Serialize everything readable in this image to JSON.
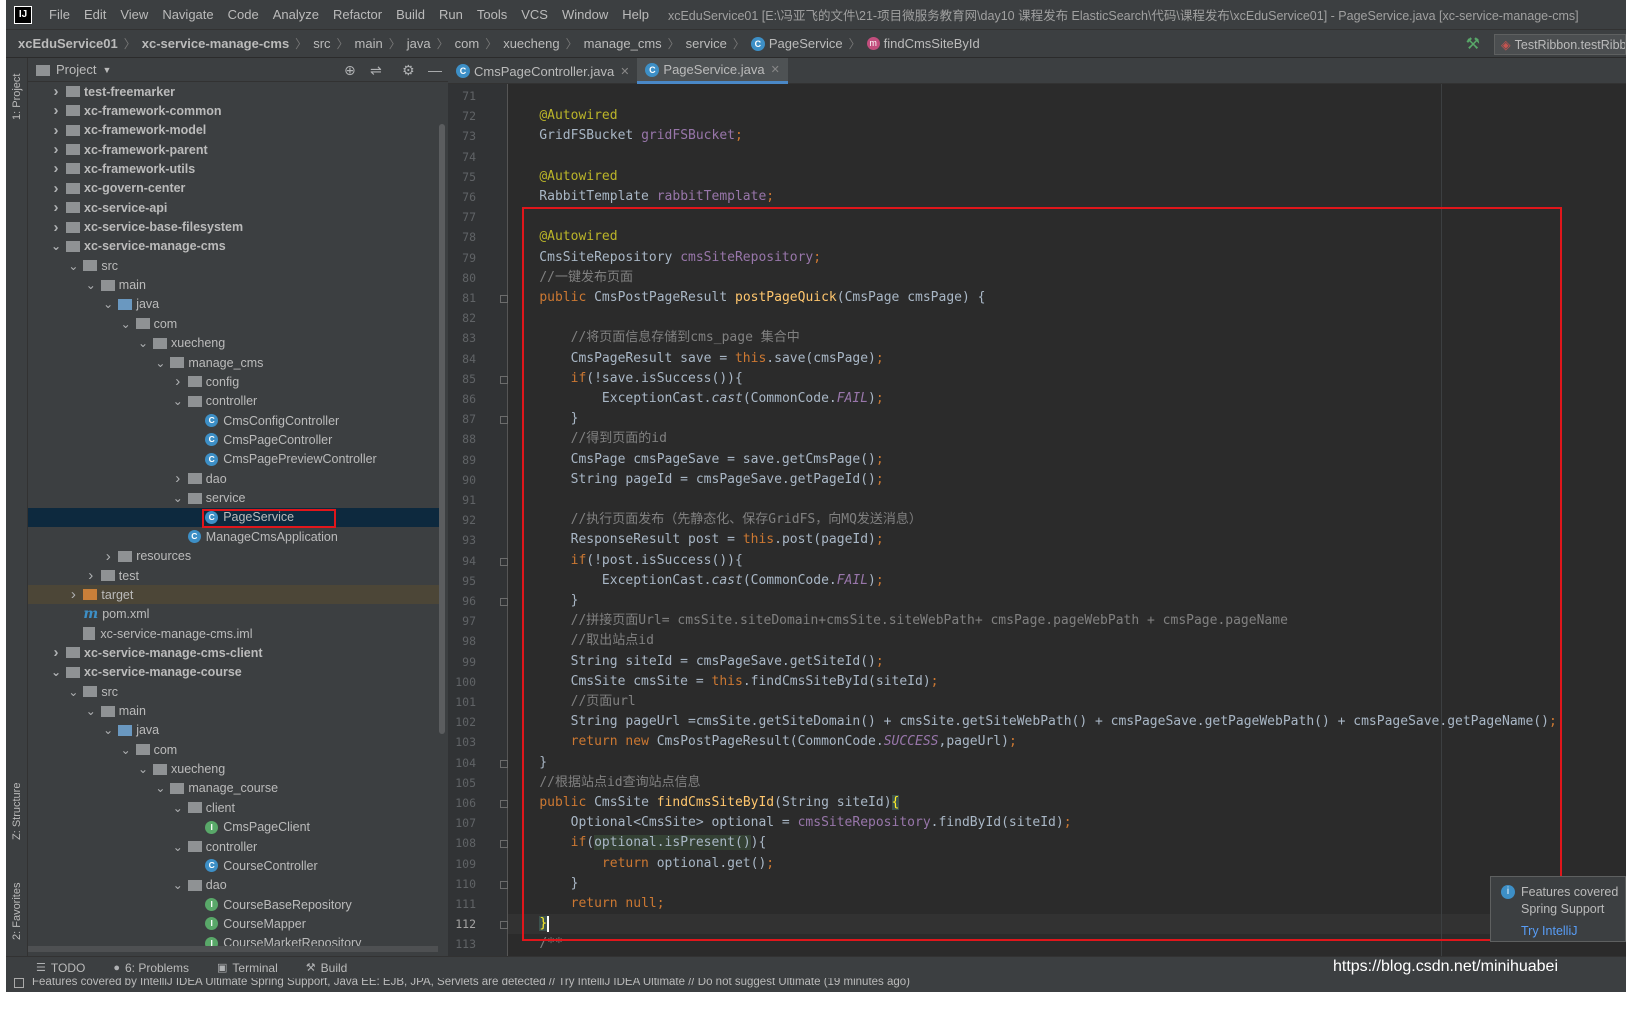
{
  "window": {
    "menu": [
      "File",
      "Edit",
      "View",
      "Navigate",
      "Code",
      "Analyze",
      "Refactor",
      "Build",
      "Run",
      "Tools",
      "VCS",
      "Window",
      "Help"
    ],
    "title": "xcEduService01 [E:\\冯亚飞的文件\\21-项目微服务教育网\\day10 课程发布 ElasticSearch\\代码\\课程发布\\xcEduService01] - PageService.java [xc-service-manage-cms]"
  },
  "breadcrumb": {
    "items": [
      "xcEduService01",
      "xc-service-manage-cms",
      "src",
      "main",
      "java",
      "com",
      "xuecheng",
      "manage_cms",
      "service",
      "PageService",
      "findCmsSiteById"
    ],
    "run_config": "TestRibbon.testRibbon"
  },
  "side_tabs": {
    "project": "1: Project",
    "structure": "Z: Structure",
    "favorites": "2: Favorites"
  },
  "project_panel": {
    "title": "Project",
    "tree": [
      {
        "label": "test-freemarker",
        "depth": 0,
        "arrow": "right",
        "icon": "module-folder",
        "bold": true
      },
      {
        "label": "xc-framework-common",
        "depth": 0,
        "arrow": "right",
        "icon": "module-folder",
        "bold": true
      },
      {
        "label": "xc-framework-model",
        "depth": 0,
        "arrow": "right",
        "icon": "module-folder",
        "bold": true
      },
      {
        "label": "xc-framework-parent",
        "depth": 0,
        "arrow": "right",
        "icon": "module-folder",
        "bold": true
      },
      {
        "label": "xc-framework-utils",
        "depth": 0,
        "arrow": "right",
        "icon": "module-folder",
        "bold": true
      },
      {
        "label": "xc-govern-center",
        "depth": 0,
        "arrow": "right",
        "icon": "module-folder",
        "bold": true
      },
      {
        "label": "xc-service-api",
        "depth": 0,
        "arrow": "right",
        "icon": "module-folder",
        "bold": true
      },
      {
        "label": "xc-service-base-filesystem",
        "depth": 0,
        "arrow": "right",
        "icon": "module-folder",
        "bold": true
      },
      {
        "label": "xc-service-manage-cms",
        "depth": 0,
        "arrow": "down",
        "icon": "module-folder",
        "bold": true
      },
      {
        "label": "src",
        "depth": 1,
        "arrow": "down",
        "icon": "folder"
      },
      {
        "label": "main",
        "depth": 2,
        "arrow": "down",
        "icon": "folder"
      },
      {
        "label": "java",
        "depth": 3,
        "arrow": "down",
        "icon": "folder-blue"
      },
      {
        "label": "com",
        "depth": 4,
        "arrow": "down",
        "icon": "package"
      },
      {
        "label": "xuecheng",
        "depth": 5,
        "arrow": "down",
        "icon": "package"
      },
      {
        "label": "manage_cms",
        "depth": 6,
        "arrow": "down",
        "icon": "package"
      },
      {
        "label": "config",
        "depth": 7,
        "arrow": "right",
        "icon": "package"
      },
      {
        "label": "controller",
        "depth": 7,
        "arrow": "down",
        "icon": "package"
      },
      {
        "label": "CmsConfigController",
        "depth": 8,
        "arrow": "",
        "icon": "class"
      },
      {
        "label": "CmsPageController",
        "depth": 8,
        "arrow": "",
        "icon": "class"
      },
      {
        "label": "CmsPagePreviewController",
        "depth": 8,
        "arrow": "",
        "icon": "class"
      },
      {
        "label": "dao",
        "depth": 7,
        "arrow": "right",
        "icon": "package"
      },
      {
        "label": "service",
        "depth": 7,
        "arrow": "down",
        "icon": "package"
      },
      {
        "label": "PageService",
        "depth": 8,
        "arrow": "",
        "icon": "class",
        "selected": true
      },
      {
        "label": "ManageCmsApplication",
        "depth": 7,
        "arrow": "",
        "icon": "class"
      },
      {
        "label": "resources",
        "depth": 3,
        "arrow": "right",
        "icon": "folder"
      },
      {
        "label": "test",
        "depth": 2,
        "arrow": "right",
        "icon": "folder"
      },
      {
        "label": "target",
        "depth": 1,
        "arrow": "right",
        "icon": "folder-orange",
        "highlight": true
      },
      {
        "label": "pom.xml",
        "depth": 1,
        "arrow": "",
        "icon": "maven"
      },
      {
        "label": "xc-service-manage-cms.iml",
        "depth": 1,
        "arrow": "",
        "icon": "file"
      },
      {
        "label": "xc-service-manage-cms-client",
        "depth": 0,
        "arrow": "right",
        "icon": "module-folder",
        "bold": true
      },
      {
        "label": "xc-service-manage-course",
        "depth": 0,
        "arrow": "down",
        "icon": "module-folder",
        "bold": true
      },
      {
        "label": "src",
        "depth": 1,
        "arrow": "down",
        "icon": "folder"
      },
      {
        "label": "main",
        "depth": 2,
        "arrow": "down",
        "icon": "folder"
      },
      {
        "label": "java",
        "depth": 3,
        "arrow": "down",
        "icon": "folder-blue"
      },
      {
        "label": "com",
        "depth": 4,
        "arrow": "down",
        "icon": "package"
      },
      {
        "label": "xuecheng",
        "depth": 5,
        "arrow": "down",
        "icon": "package"
      },
      {
        "label": "manage_course",
        "depth": 6,
        "arrow": "down",
        "icon": "package"
      },
      {
        "label": "client",
        "depth": 7,
        "arrow": "down",
        "icon": "package"
      },
      {
        "label": "CmsPageClient",
        "depth": 8,
        "arrow": "",
        "icon": "interface"
      },
      {
        "label": "controller",
        "depth": 7,
        "arrow": "down",
        "icon": "package"
      },
      {
        "label": "CourseController",
        "depth": 8,
        "arrow": "",
        "icon": "class"
      },
      {
        "label": "dao",
        "depth": 7,
        "arrow": "down",
        "icon": "package"
      },
      {
        "label": "CourseBaseRepository",
        "depth": 8,
        "arrow": "",
        "icon": "interface"
      },
      {
        "label": "CourseMapper",
        "depth": 8,
        "arrow": "",
        "icon": "interface"
      },
      {
        "label": "CourseMarketRepository",
        "depth": 8,
        "arrow": "",
        "icon": "interface"
      }
    ]
  },
  "editor": {
    "tabs": [
      {
        "label": "CmsPageController.java",
        "active": false
      },
      {
        "label": "PageService.java",
        "active": true
      }
    ],
    "current_line": 112,
    "lines": [
      {
        "n": 71,
        "t": []
      },
      {
        "n": 72,
        "t": [
          [
            "    ",
            ""
          ],
          [
            "@Autowired",
            "ann"
          ]
        ]
      },
      {
        "n": 73,
        "t": [
          [
            "    GridFSBucket ",
            ""
          ],
          [
            "gridFSBucket",
            "fld"
          ],
          [
            ";",
            "kw"
          ]
        ]
      },
      {
        "n": 74,
        "t": []
      },
      {
        "n": 75,
        "t": [
          [
            "    ",
            ""
          ],
          [
            "@Autowired",
            "ann"
          ]
        ]
      },
      {
        "n": 76,
        "t": [
          [
            "    RabbitTemplate ",
            ""
          ],
          [
            "rabbitTemplate",
            "fld"
          ],
          [
            ";",
            "kw"
          ]
        ]
      },
      {
        "n": 77,
        "t": []
      },
      {
        "n": 78,
        "t": [
          [
            "    ",
            ""
          ],
          [
            "@Autowired",
            "ann"
          ]
        ]
      },
      {
        "n": 79,
        "t": [
          [
            "    CmsSiteRepository ",
            ""
          ],
          [
            "cmsSiteRepository",
            "fld"
          ],
          [
            ";",
            "kw"
          ]
        ]
      },
      {
        "n": 80,
        "t": [
          [
            "    ",
            ""
          ],
          [
            "//一键发布页面",
            "cm"
          ]
        ]
      },
      {
        "n": 81,
        "t": [
          [
            "    ",
            ""
          ],
          [
            "public ",
            "kw"
          ],
          [
            "CmsPostPageResult ",
            ""
          ],
          [
            "postPageQuick",
            "fn"
          ],
          [
            "(CmsPage cmsPage) {",
            ""
          ]
        ]
      },
      {
        "n": 82,
        "t": []
      },
      {
        "n": 83,
        "t": [
          [
            "        ",
            ""
          ],
          [
            "//将页面信息存储到cms_page 集合中",
            "cm"
          ]
        ]
      },
      {
        "n": 84,
        "t": [
          [
            "        CmsPageResult save = ",
            ""
          ],
          [
            "this",
            "kw"
          ],
          [
            ".save(cmsPage)",
            ""
          ],
          [
            ";",
            "kw"
          ]
        ]
      },
      {
        "n": 85,
        "t": [
          [
            "        ",
            ""
          ],
          [
            "if",
            "kw"
          ],
          [
            "(!save.isSuccess()){",
            ""
          ]
        ]
      },
      {
        "n": 86,
        "t": [
          [
            "            ExceptionCast.",
            ""
          ],
          [
            "cast",
            "it"
          ],
          [
            "(CommonCode.",
            ""
          ],
          [
            "FAIL",
            "fld it"
          ],
          [
            ")",
            ""
          ],
          [
            ";",
            "kw"
          ]
        ]
      },
      {
        "n": 87,
        "t": [
          [
            "        }",
            ""
          ]
        ]
      },
      {
        "n": 88,
        "t": [
          [
            "        ",
            ""
          ],
          [
            "//得到页面的id",
            "cm"
          ]
        ]
      },
      {
        "n": 89,
        "t": [
          [
            "        CmsPage cmsPageSave = save.getCmsPage()",
            ""
          ],
          [
            ";",
            "kw"
          ]
        ]
      },
      {
        "n": 90,
        "t": [
          [
            "        String pageId = cmsPageSave.getPageId()",
            ""
          ],
          [
            ";",
            "kw"
          ]
        ]
      },
      {
        "n": 91,
        "t": []
      },
      {
        "n": 92,
        "t": [
          [
            "        ",
            ""
          ],
          [
            "//执行页面发布（先静态化、保存GridFS，向MQ发送消息）",
            "cm"
          ]
        ]
      },
      {
        "n": 93,
        "t": [
          [
            "        ResponseResult post = ",
            ""
          ],
          [
            "this",
            "kw"
          ],
          [
            ".post(pageId)",
            ""
          ],
          [
            ";",
            "kw"
          ]
        ]
      },
      {
        "n": 94,
        "t": [
          [
            "        ",
            ""
          ],
          [
            "if",
            "kw"
          ],
          [
            "(!post.isSuccess()){",
            ""
          ]
        ]
      },
      {
        "n": 95,
        "t": [
          [
            "            ExceptionCast.",
            ""
          ],
          [
            "cast",
            "it"
          ],
          [
            "(CommonCode.",
            ""
          ],
          [
            "FAIL",
            "fld it"
          ],
          [
            ")",
            ""
          ],
          [
            ";",
            "kw"
          ]
        ]
      },
      {
        "n": 96,
        "t": [
          [
            "        }",
            ""
          ]
        ]
      },
      {
        "n": 97,
        "t": [
          [
            "        ",
            ""
          ],
          [
            "//拼接页面Url= cmsSite.siteDomain+cmsSite.siteWebPath+ cmsPage.pageWebPath + cmsPage.pageName",
            "cm"
          ]
        ]
      },
      {
        "n": 98,
        "t": [
          [
            "        ",
            ""
          ],
          [
            "//取出站点id",
            "cm"
          ]
        ]
      },
      {
        "n": 99,
        "t": [
          [
            "        String siteId = cmsPageSave.getSiteId()",
            ""
          ],
          [
            ";",
            "kw"
          ]
        ]
      },
      {
        "n": 100,
        "t": [
          [
            "        CmsSite cmsSite = ",
            ""
          ],
          [
            "this",
            "kw"
          ],
          [
            ".findCmsSiteById(siteId)",
            ""
          ],
          [
            ";",
            "kw"
          ]
        ]
      },
      {
        "n": 101,
        "t": [
          [
            "        ",
            ""
          ],
          [
            "//页面url",
            "cm"
          ]
        ]
      },
      {
        "n": 102,
        "t": [
          [
            "        String pageUrl =cmsSite.getSiteDomain() + cmsSite.getSiteWebPath() + cmsPageSave.getPageWebPath() + cmsPageSave.getPageName()",
            ""
          ],
          [
            ";",
            "kw"
          ]
        ]
      },
      {
        "n": 103,
        "t": [
          [
            "        ",
            ""
          ],
          [
            "return new ",
            "kw"
          ],
          [
            "CmsPostPageResult(CommonCode.",
            ""
          ],
          [
            "SUCCESS",
            "fld it"
          ],
          [
            ",pageUrl)",
            ""
          ],
          [
            ";",
            "kw"
          ]
        ]
      },
      {
        "n": 104,
        "t": [
          [
            "    }",
            ""
          ]
        ]
      },
      {
        "n": 105,
        "t": [
          [
            "    ",
            ""
          ],
          [
            "//根据站点id查询站点信息",
            "cm"
          ]
        ]
      },
      {
        "n": 106,
        "t": [
          [
            "    ",
            ""
          ],
          [
            "public ",
            "kw"
          ],
          [
            "CmsSite ",
            ""
          ],
          [
            "findCmsSiteById",
            "fn"
          ],
          [
            "(String siteId)",
            ""
          ],
          [
            "{",
            "brace-hl"
          ]
        ]
      },
      {
        "n": 107,
        "t": [
          [
            "        Optional<CmsSite> optional = ",
            ""
          ],
          [
            "cmsSiteRepository",
            "fld"
          ],
          [
            ".findById(siteId)",
            ""
          ],
          [
            ";",
            "kw"
          ]
        ]
      },
      {
        "n": 108,
        "t": [
          [
            "        ",
            ""
          ],
          [
            "if",
            "kw"
          ],
          [
            "(",
            ""
          ],
          [
            "optional.isPresent()",
            "match-hl"
          ],
          [
            "){",
            ""
          ]
        ]
      },
      {
        "n": 109,
        "t": [
          [
            "            ",
            ""
          ],
          [
            "return ",
            "kw"
          ],
          [
            "optional.get()",
            ""
          ],
          [
            ";",
            "kw"
          ]
        ]
      },
      {
        "n": 110,
        "t": [
          [
            "        }",
            ""
          ]
        ]
      },
      {
        "n": 111,
        "t": [
          [
            "        ",
            ""
          ],
          [
            "return null;",
            "kw"
          ]
        ]
      },
      {
        "n": 112,
        "t": [
          [
            "    ",
            ""
          ],
          [
            "}",
            "brace-hl"
          ]
        ]
      },
      {
        "n": 113,
        "t": [
          [
            "    ",
            ""
          ],
          [
            "/**",
            "cm"
          ]
        ]
      }
    ]
  },
  "notification": {
    "title": "Features covered",
    "subtitle": "Spring Support",
    "link": "Try IntelliJ"
  },
  "tool_windows": [
    "TODO",
    "6: Problems",
    "Terminal",
    "Build"
  ],
  "watermark": "https://blog.csdn.net/minihuabei",
  "status": "Features covered by IntelliJ IDEA Ultimate Spring Support, Java EE: EJB, JPA, Servlets are detected // Try IntelliJ IDEA Ultimate // Do not suggest Ultimate (19 minutes ago)"
}
